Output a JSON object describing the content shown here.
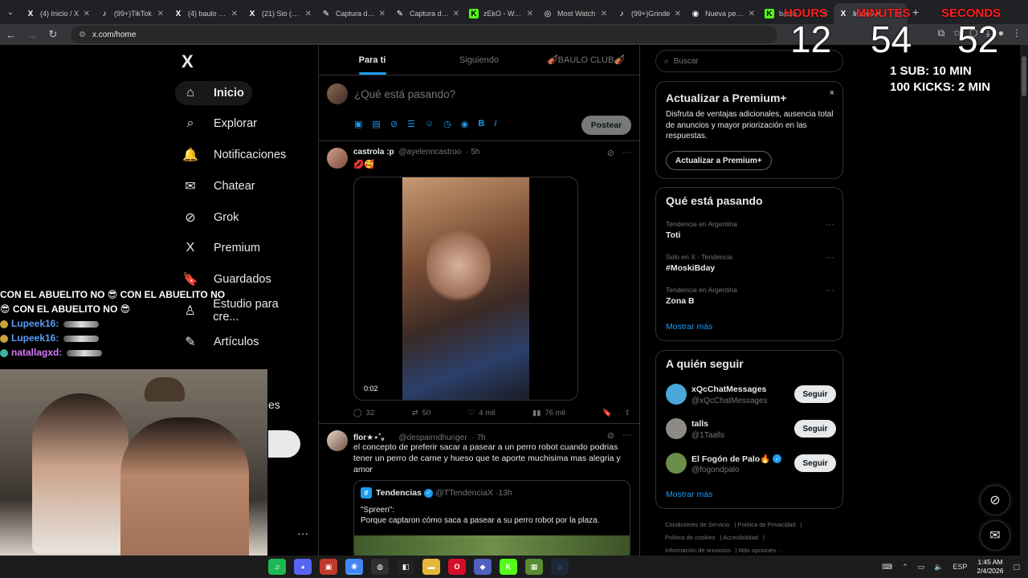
{
  "browser": {
    "tabs": [
      {
        "title": "(4) Inicio / X",
        "icon": "x-logo-icon",
        "glyph": "X",
        "color": "#202124",
        "active": false
      },
      {
        "title": "(99+)TikTok",
        "icon": "tiktok-icon",
        "glyph": "♪",
        "color": "#202124",
        "active": false
      },
      {
        "title": "(4) baulo (@",
        "icon": "x-logo-icon",
        "glyph": "X",
        "color": "#202124",
        "active": false
      },
      {
        "title": "(21) Sio (@S",
        "icon": "x-logo-icon",
        "glyph": "X",
        "color": "#202124",
        "active": false
      },
      {
        "title": "Captura de p",
        "icon": "pen-icon",
        "glyph": "✎",
        "color": "#202124",
        "active": false
      },
      {
        "title": "Captura de p",
        "icon": "pen-icon",
        "glyph": "✎",
        "color": "#202124",
        "active": false
      },
      {
        "title": "zEkO - Watc",
        "icon": "kick-icon",
        "glyph": "K",
        "color": "#53fc18",
        "active": false
      },
      {
        "title": "Most Watch",
        "icon": "streams-icon",
        "glyph": "◎",
        "color": "#202124",
        "active": false
      },
      {
        "title": "(99+)Grinde",
        "icon": "tiktok-icon",
        "glyph": "♪",
        "color": "#202124",
        "active": false
      },
      {
        "title": "Nueva pesta",
        "icon": "chrome-icon",
        "glyph": "◉",
        "color": "#202124",
        "active": false
      },
      {
        "title": "baulo",
        "icon": "kick-icon",
        "glyph": "K",
        "color": "#53fc18",
        "active": false
      },
      {
        "title": "Inicio / X",
        "icon": "x-logo-icon",
        "glyph": "X",
        "color": "#202124",
        "active": true
      }
    ],
    "url": "x.com/home"
  },
  "nav": {
    "logo": "X",
    "items": [
      {
        "label": "Inicio",
        "icon": "home-icon",
        "glyph": "⌂",
        "active": true
      },
      {
        "label": "Explorar",
        "icon": "search-icon",
        "glyph": "⌕"
      },
      {
        "label": "Notificaciones",
        "icon": "bell-icon",
        "glyph": "🔔"
      },
      {
        "label": "Chatear",
        "icon": "mail-icon",
        "glyph": "✉"
      },
      {
        "label": "Grok",
        "icon": "grok-icon",
        "glyph": "⊘"
      },
      {
        "label": "Premium",
        "icon": "x-logo-icon",
        "glyph": "X"
      },
      {
        "label": "Guardados",
        "icon": "bookmark-icon",
        "glyph": "🔖"
      },
      {
        "label": "Estudio para cre...",
        "icon": "creator-studio-icon",
        "glyph": "♙"
      },
      {
        "label": "Artículos",
        "icon": "articles-icon",
        "glyph": "✎"
      }
    ],
    "fragment": "es",
    "more": "···"
  },
  "timeline": {
    "tabs": [
      {
        "label": "Para ti",
        "active": true
      },
      {
        "label": "Siguiendo",
        "active": false
      },
      {
        "label": "🎻BAULO CLUB🎻",
        "active": false
      }
    ],
    "composer": {
      "placeholder": "¿Qué está pasando?",
      "post_label": "Postear"
    },
    "tweets": [
      {
        "name": "castrola :p",
        "handle": "@ayelenncastroo",
        "time": "5h",
        "text": "💋🥰",
        "video_duration": "0:02",
        "replies": "32",
        "reposts": "50",
        "likes": "4 mil",
        "views": "76 mil"
      },
      {
        "name": "flor★⋆˚｡",
        "handle": "@despairndhunger",
        "time": "7h",
        "text": "el concepto de preferir sacar a pasear a un perro robot cuando podrias tener un perro de carne y hueso que te aporte muchisima mas alegria y amor",
        "quote": {
          "name": "Tendencias",
          "handle": "@TTendenciaX",
          "time": "13h",
          "text_line1": "\"Spreen\":",
          "text_line2": "Porque captaron cómo saca a pasear a su perro robot por la plaza."
        }
      }
    ]
  },
  "sidebar": {
    "search_placeholder": "Buscar",
    "premium": {
      "title": "Actualizar a Premium+",
      "description": "Disfruta de ventajas adicionales, ausencia total de anuncios y mayor priorización en las respuestas.",
      "button": "Actualizar a Premium+",
      "close": "×"
    },
    "trends": {
      "title": "Qué está pasando",
      "items": [
        {
          "context": "Tendencia en Argentina",
          "name": "Toti"
        },
        {
          "context": "Solo en X · Tendencia",
          "name": "#MoskiBday"
        },
        {
          "context": "Tendencia en Argentina",
          "name": "Zona B"
        }
      ],
      "show_more": "Mostrar más"
    },
    "follow": {
      "title": "A quién seguir",
      "users": [
        {
          "name": "xQcChatMessages",
          "handle": "@xQcChatMessages",
          "verified": false,
          "avatar_color": "#4aa7d9"
        },
        {
          "name": "talls",
          "handle": "@1Taalls",
          "verified": false,
          "avatar_color": "#8d8a86"
        },
        {
          "name": "El Fogón de Palo🔥",
          "handle": "@fogondpalo",
          "verified": true,
          "avatar_color": "#6b8f4a"
        }
      ],
      "button": "Seguir",
      "show_more": "Mostrar más"
    },
    "footer": [
      "Condiciones de Servicio",
      "Política de Privacidad",
      "Política de cookies",
      "Accesibilidad",
      "Información de anuncios",
      "Más opciones ···"
    ]
  },
  "overlay": {
    "timer": {
      "hours_label": "HOURS",
      "minutes_label": "MINUTES",
      "seconds_label": "SECONDS",
      "hours": "12",
      "minutes": "54",
      "seconds": "52",
      "rule1": "1 SUB: 10 MIN",
      "rule2": "100 KICKS: 2 MIN"
    },
    "chat": [
      {
        "text": "CON EL ABUELITO NO 😎 CON EL ABUELITO NO"
      },
      {
        "text": "😎 CON EL ABUELITO NO 😎"
      },
      {
        "user": "Lupeek16:"
      },
      {
        "user": "Lupeek16:"
      },
      {
        "user": "natallagxd:"
      }
    ]
  },
  "taskbar": {
    "apps": [
      {
        "name": "spotify-icon",
        "glyph": "♫",
        "color": "#1db954"
      },
      {
        "name": "discord-icon",
        "glyph": "◕",
        "color": "#5865f2"
      },
      {
        "name": "stream-app-icon",
        "glyph": "▣",
        "color": "#c0392b"
      },
      {
        "name": "chrome-icon",
        "glyph": "◉",
        "color": "#4285f4",
        "active": true
      },
      {
        "name": "obs-icon",
        "glyph": "◍",
        "color": "#302e31"
      },
      {
        "name": "capcut-icon",
        "glyph": "◧",
        "color": "#222"
      },
      {
        "name": "folder-icon",
        "glyph": "▬",
        "color": "#e5b83a"
      },
      {
        "name": "opera-icon",
        "glyph": "O",
        "color": "#d31027"
      },
      {
        "name": "app-icon",
        "glyph": "◆",
        "color": "#5060c0"
      },
      {
        "name": "kick-icon",
        "glyph": "K",
        "color": "#53fc18"
      },
      {
        "name": "minecraft-icon",
        "glyph": "▦",
        "color": "#5b8c32"
      },
      {
        "name": "steam-icon",
        "glyph": "◌",
        "color": "#1b2838"
      }
    ],
    "lang": "ESP",
    "time": "1:45 AM",
    "date": "2/4/2026"
  }
}
